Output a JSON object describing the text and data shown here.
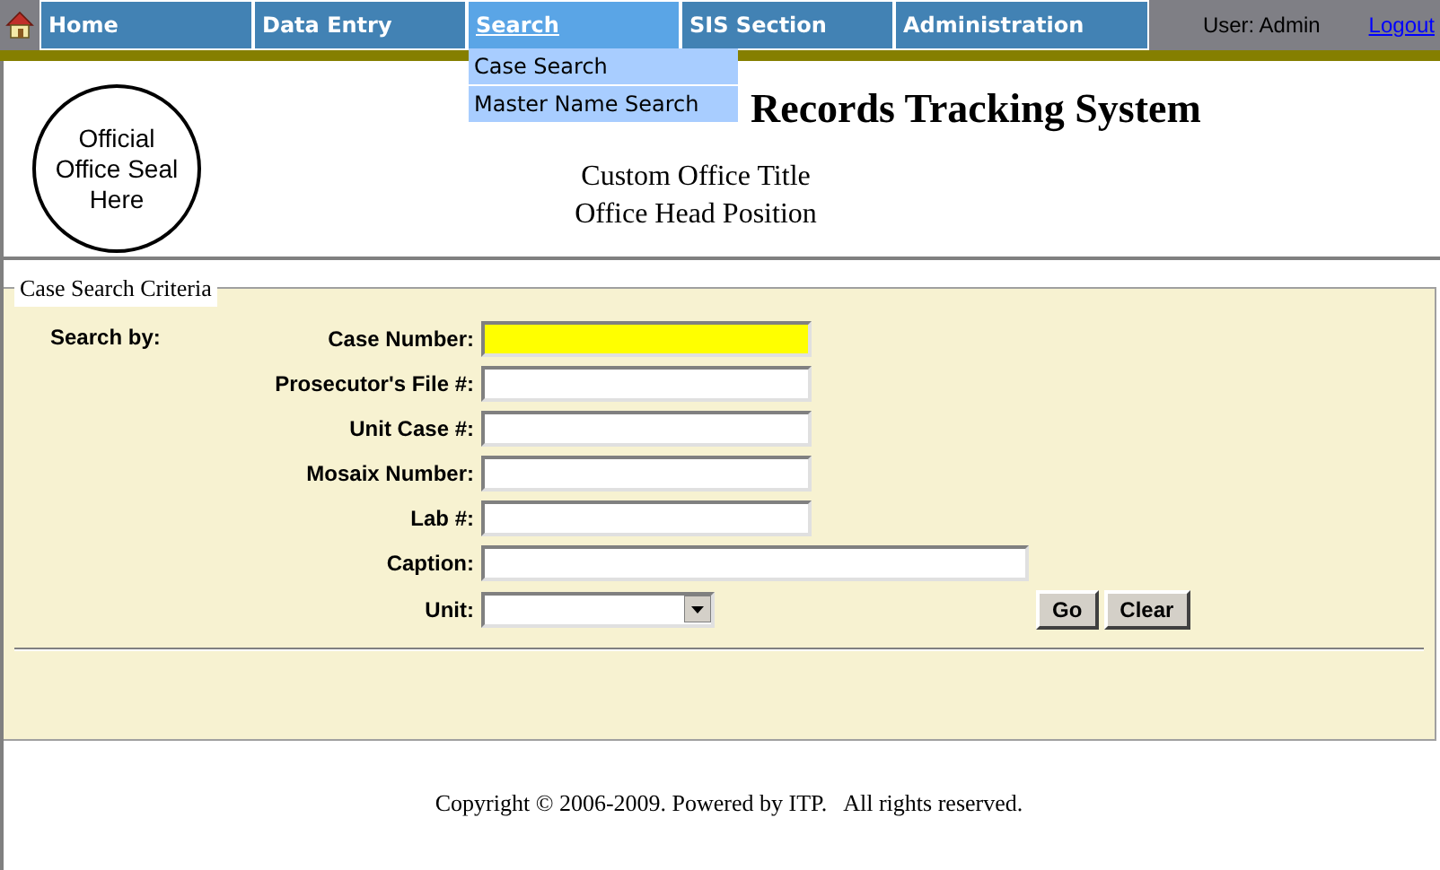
{
  "nav": {
    "items": [
      {
        "label": "Home",
        "selected": false
      },
      {
        "label": "Data Entry",
        "selected": false
      },
      {
        "label": "Search",
        "selected": true
      },
      {
        "label": "SIS Section",
        "selected": false
      },
      {
        "label": "Administration",
        "selected": false
      }
    ],
    "user": "User: Admin",
    "logout": "Logout"
  },
  "dropdown": {
    "items": [
      "Case Search",
      "Master Name Search"
    ]
  },
  "header": {
    "seal": "Official Office Seal Here",
    "title": "Records Tracking System",
    "office_title": "Custom Office Title",
    "office_head": "Office Head Position"
  },
  "form": {
    "legend": "Case Search Criteria",
    "search_by": "Search by:",
    "fields": [
      {
        "label": "Case Number:",
        "kind": "text",
        "focused": true
      },
      {
        "label": "Prosecutor's File #:",
        "kind": "text",
        "focused": false
      },
      {
        "label": "Unit Case #:",
        "kind": "text",
        "focused": false
      },
      {
        "label": "Mosaix Number:",
        "kind": "text",
        "focused": false
      },
      {
        "label": "Lab #:",
        "kind": "text",
        "focused": false
      },
      {
        "label": "Caption:",
        "kind": "wide",
        "focused": false
      },
      {
        "label": "Unit:",
        "kind": "select"
      }
    ],
    "buttons": [
      "Go",
      "Clear"
    ]
  },
  "footer": "Copyright © 2006-2009. Powered by ITP.   All rights reserved."
}
